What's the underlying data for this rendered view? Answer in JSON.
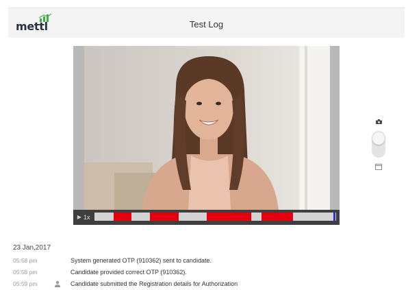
{
  "app": {
    "logo_text": "mettl",
    "title": "Test Log"
  },
  "colors": {
    "accent_red": "#e4000f",
    "timeline_track": "#d3d3d3",
    "playhead": "#3030d0",
    "logo_green": "#3fae49"
  },
  "player": {
    "play_icon": "play-icon",
    "speed_label": "1x",
    "flagged_segments": [
      {
        "start": 0.08,
        "end": 0.155
      },
      {
        "start": 0.23,
        "end": 0.35
      },
      {
        "start": 0.465,
        "end": 0.65
      },
      {
        "start": 0.69,
        "end": 0.82
      }
    ],
    "playhead_position": 0.99
  },
  "side_controls": {
    "top_icon": "camera-icon",
    "bottom_icon": "window-icon",
    "toggle_on": false
  },
  "log": {
    "date": "23 Jan,2017",
    "entries": [
      {
        "time": "05:58 pm",
        "icon": "",
        "message": "System generated OTP (910362) sent to candidate."
      },
      {
        "time": "05:58 pm",
        "icon": "",
        "message": "Candidate provided correct OTP (910362)."
      },
      {
        "time": "05:59 pm",
        "icon": "user-icon",
        "message": "Candidate submitted the Registration details for Authorization"
      }
    ]
  }
}
